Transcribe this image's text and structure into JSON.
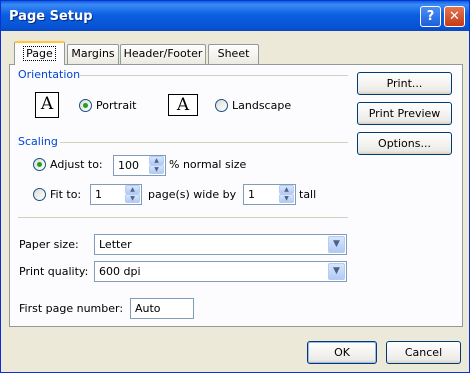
{
  "window": {
    "title": "Page Setup"
  },
  "titlebar": {
    "help_glyph": "?",
    "close_glyph": "✕"
  },
  "tabs": [
    {
      "label": "Page",
      "active": true
    },
    {
      "label": "Margins"
    },
    {
      "label": "Header/Footer"
    },
    {
      "label": "Sheet"
    }
  ],
  "orientation": {
    "title": "Orientation",
    "glyph": "A",
    "portrait": "Portrait",
    "landscape": "Landscape",
    "selected": "portrait"
  },
  "scaling": {
    "title": "Scaling",
    "adjust_label": "Adjust to:",
    "adjust_value": "100",
    "adjust_suffix": "% normal size",
    "fit_label": "Fit to:",
    "fit_wide_value": "1",
    "fit_wide_suffix": "page(s) wide by",
    "fit_tall_value": "1",
    "fit_tall_suffix": "tall",
    "selected": "adjust"
  },
  "paper_size": {
    "label": "Paper size:",
    "value": "Letter"
  },
  "print_quality": {
    "label": "Print quality:",
    "value": "600 dpi"
  },
  "first_page": {
    "label": "First page number:",
    "value": "Auto"
  },
  "side_buttons": {
    "print": "Print...",
    "preview": "Print Preview",
    "options": "Options..."
  },
  "footer_buttons": {
    "ok": "OK",
    "cancel": "Cancel"
  },
  "icons": {
    "help": "help-icon",
    "close": "close-icon",
    "dropdown": "chevron-down-icon",
    "spin_up": "spin-up-icon",
    "spin_down": "spin-down-icon"
  }
}
